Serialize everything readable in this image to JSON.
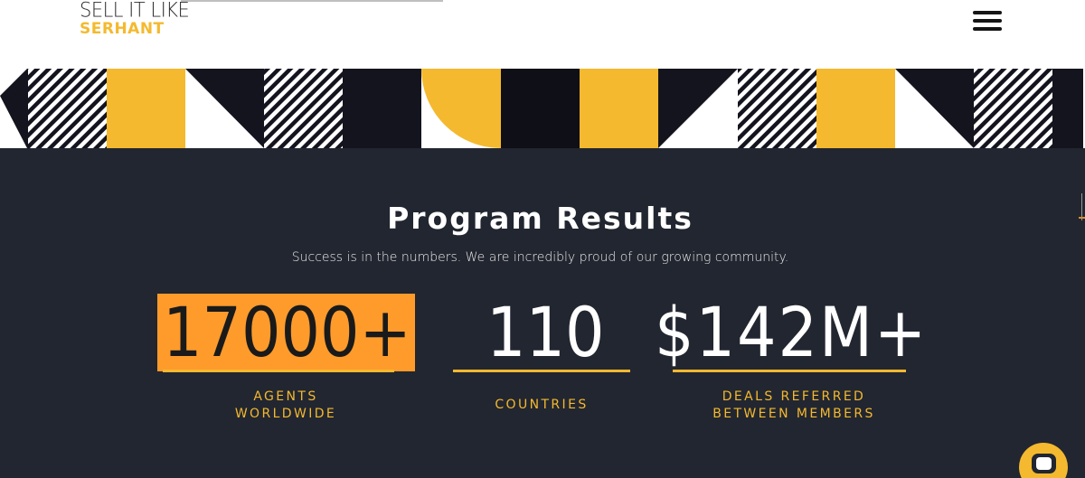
{
  "header": {
    "logo_line1": "SELL IT LIKE",
    "logo_line2": "SERHANT",
    "menu_icon": "hamburger-menu-icon"
  },
  "results": {
    "title": "Program Results",
    "subtitle": "Success is in the numbers. We are incredibly proud of our growing community.",
    "stats": [
      {
        "number": "17000+",
        "label_line1": "AGENTS",
        "label_line2": "WORLDWIDE"
      },
      {
        "number": "110",
        "label_line1": "COUNTRIES",
        "label_line2": ""
      },
      {
        "number": "$142M+",
        "label_line1": "DEALS REFERRED",
        "label_line2": "BETWEEN MEMBERS"
      }
    ]
  },
  "chat": {
    "icon": "chat-bubble-icon"
  },
  "colors": {
    "accent": "#f4b92f",
    "dark": "#222630",
    "highlight": "#ff9b2b",
    "navy": "#14141e"
  }
}
